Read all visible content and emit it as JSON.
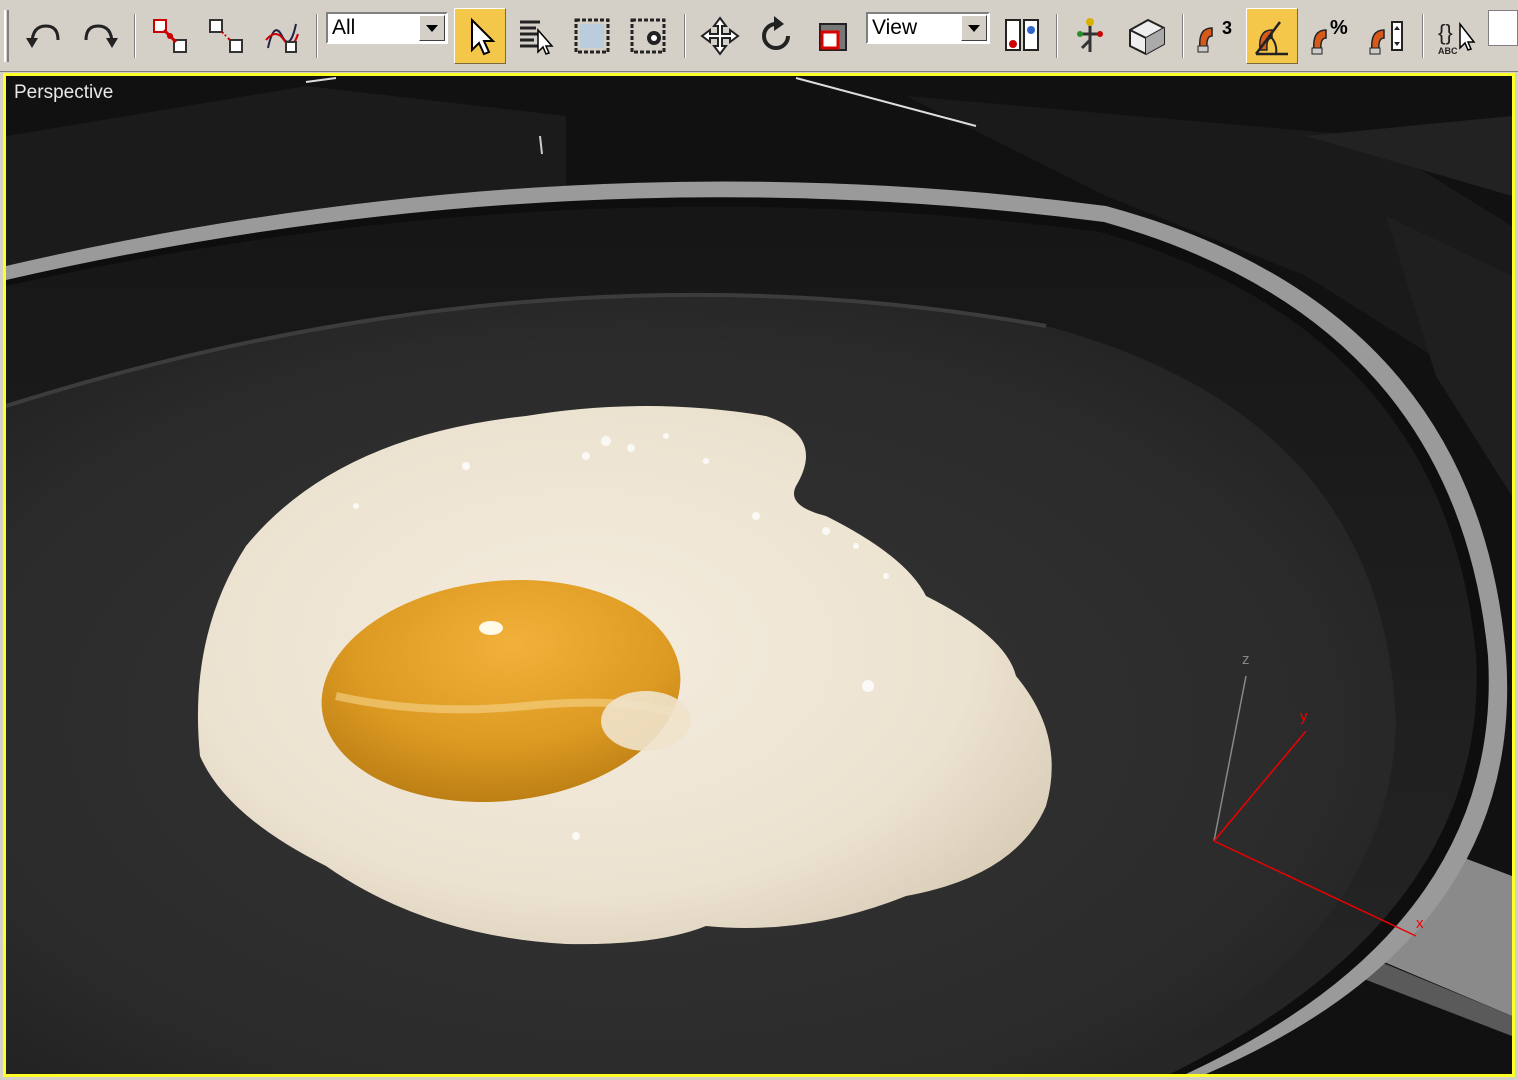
{
  "toolbar": {
    "selection_filter": {
      "value": "All"
    },
    "reference_coord": {
      "value": "View"
    },
    "buttons": [
      {
        "id": "undo",
        "icon": "undo-icon"
      },
      {
        "id": "redo",
        "icon": "redo-icon"
      },
      {
        "id": "select-and-link",
        "icon": "link-icon"
      },
      {
        "id": "unlink-selection",
        "icon": "unlink-icon"
      },
      {
        "id": "bind-to-space-warp",
        "icon": "space-warp-icon"
      },
      {
        "id": "select-object",
        "icon": "arrow-cursor-icon",
        "active": true
      },
      {
        "id": "select-by-name",
        "icon": "select-by-name-icon"
      },
      {
        "id": "rectangular-selection",
        "icon": "rect-selection-icon"
      },
      {
        "id": "window-crossing",
        "icon": "window-crossing-icon"
      },
      {
        "id": "select-and-move",
        "icon": "move-icon"
      },
      {
        "id": "select-and-rotate",
        "icon": "rotate-icon"
      },
      {
        "id": "select-and-scale",
        "icon": "scale-icon"
      },
      {
        "id": "use-pivot-center",
        "icon": "pivot-center-icon"
      },
      {
        "id": "select-and-manipulate",
        "icon": "manipulate-icon"
      },
      {
        "id": "keyboard-shortcut-override",
        "icon": "keyboard-override-icon"
      },
      {
        "id": "snaps-toggle",
        "icon": "snap-3-icon",
        "label": "3"
      },
      {
        "id": "angle-snap-toggle",
        "icon": "angle-snap-icon",
        "active": true
      },
      {
        "id": "percent-snap-toggle",
        "icon": "percent-snap-icon",
        "label": "%"
      },
      {
        "id": "spinner-snap-toggle",
        "icon": "spinner-snap-icon"
      },
      {
        "id": "edit-named-selection-sets",
        "icon": "named-selection-icon",
        "label": "ABC"
      }
    ]
  },
  "viewport": {
    "label": "Perspective",
    "border_color": "#ffff2a",
    "axis_labels": {
      "x": "x",
      "y": "y",
      "z": "z"
    }
  }
}
